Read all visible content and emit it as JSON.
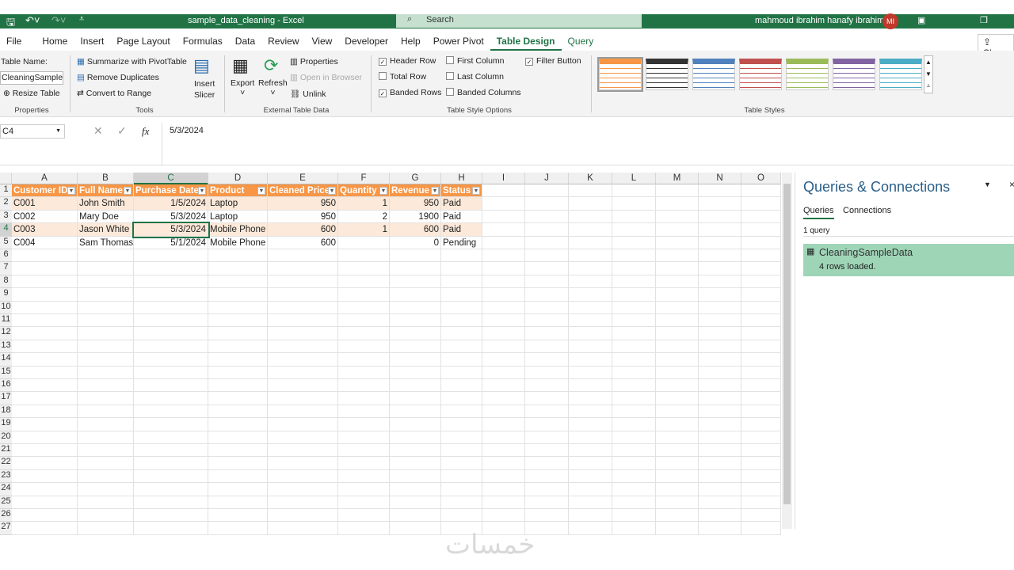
{
  "titlebar": {
    "title": "sample_data_cleaning  -  Excel",
    "search": "Search",
    "user": "mahmoud ibrahim hanafy ibrahim",
    "initials": "MI"
  },
  "tabs": [
    "File",
    "Home",
    "Insert",
    "Page Layout",
    "Formulas",
    "Data",
    "Review",
    "View",
    "Developer",
    "Help",
    "Power Pivot",
    "Table Design",
    "Query"
  ],
  "share": "Share",
  "ribbon": {
    "properties": {
      "table_name_label": "Table Name:",
      "table_name": "CleaningSampleD",
      "resize": "Resize Table",
      "label": "Properties"
    },
    "tools": {
      "summarize": "Summarize with PivotTable",
      "remove_dup": "Remove Duplicates",
      "convert": "Convert to Range",
      "insert_slicer_1": "Insert",
      "insert_slicer_2": "Slicer",
      "label": "Tools"
    },
    "external": {
      "export": "Export",
      "refresh": "Refresh",
      "properties": "Properties",
      "open_browser": "Open in Browser",
      "unlink": "Unlink",
      "label": "External Table Data"
    },
    "style_options": {
      "header_row": "Header Row",
      "total_row": "Total Row",
      "banded_rows": "Banded Rows",
      "first_column": "First Column",
      "last_column": "Last Column",
      "banded_columns": "Banded Columns",
      "filter_button": "Filter Button",
      "label": "Table Style Options",
      "checked": {
        "header_row": true,
        "total_row": false,
        "banded_rows": true,
        "first_column": false,
        "last_column": false,
        "banded_columns": false,
        "filter_button": true
      }
    },
    "styles": {
      "label": "Table Styles",
      "colors": [
        "#f79646",
        "#333333",
        "#4f81bd",
        "#c0504d",
        "#9bbb59",
        "#8064a2",
        "#4bacc6"
      ]
    }
  },
  "formula_bar": {
    "name_box": "C4",
    "value": "5/3/2024",
    "fx": "fx"
  },
  "columns": [
    "A",
    "B",
    "C",
    "D",
    "E",
    "F",
    "G",
    "H",
    "I",
    "J",
    "K",
    "L",
    "M",
    "N",
    "O"
  ],
  "table": {
    "headers": [
      "Customer ID",
      "Full Name",
      "Purchase Date",
      "Product",
      "Cleaned Price",
      "Quantity",
      "Revenue",
      "Status"
    ],
    "rows": [
      [
        "C001",
        "John Smith",
        "1/5/2024",
        "Laptop",
        "950",
        "1",
        "950",
        "Paid"
      ],
      [
        "C002",
        "Mary Doe",
        "5/3/2024",
        "Laptop",
        "950",
        "2",
        "1900",
        "Paid"
      ],
      [
        "C003",
        "Jason White",
        "5/3/2024",
        "Mobile Phone",
        "600",
        "1",
        "600",
        "Paid"
      ],
      [
        "C004",
        "Sam Thomas",
        "5/1/2024",
        "Mobile Phone",
        "600",
        "",
        "0",
        "Pending"
      ]
    ]
  },
  "panel": {
    "title": "Queries & Connections",
    "tab_queries": "Queries",
    "tab_connections": "Connections",
    "count": "1 query",
    "query_name": "CleaningSampleData",
    "query_status": "4 rows loaded."
  },
  "watermark": "خمسات",
  "colors": {
    "excel_green": "#217346",
    "table_header": "#f79646",
    "band": "#fde9d9",
    "query_selected": "#9fd5b7"
  }
}
